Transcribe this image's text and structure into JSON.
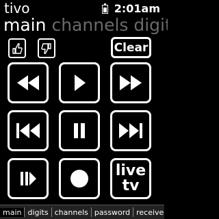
{
  "header": {
    "app_title": "tivo",
    "clock": "2:01am",
    "battery": "battery-icon"
  },
  "sections": {
    "current": "main",
    "others": "channels digits"
  },
  "thumbs": {
    "up_icon": "thumbs-up-icon",
    "down_icon": "thumbs-down-icon"
  },
  "clear_label": "Clear",
  "controls": {
    "rewind": "rewind-icon",
    "play": "play-icon",
    "fast_forward": "fast-forward-icon",
    "skip_back": "skip-back-icon",
    "pause": "pause-icon",
    "skip_forward": "skip-forward-icon",
    "slow": "slow-motion-icon",
    "record": "record-icon",
    "live_tv_label": "live\ntv"
  },
  "tabs": [
    "main",
    "digits",
    "channels",
    "password",
    "receiver"
  ]
}
